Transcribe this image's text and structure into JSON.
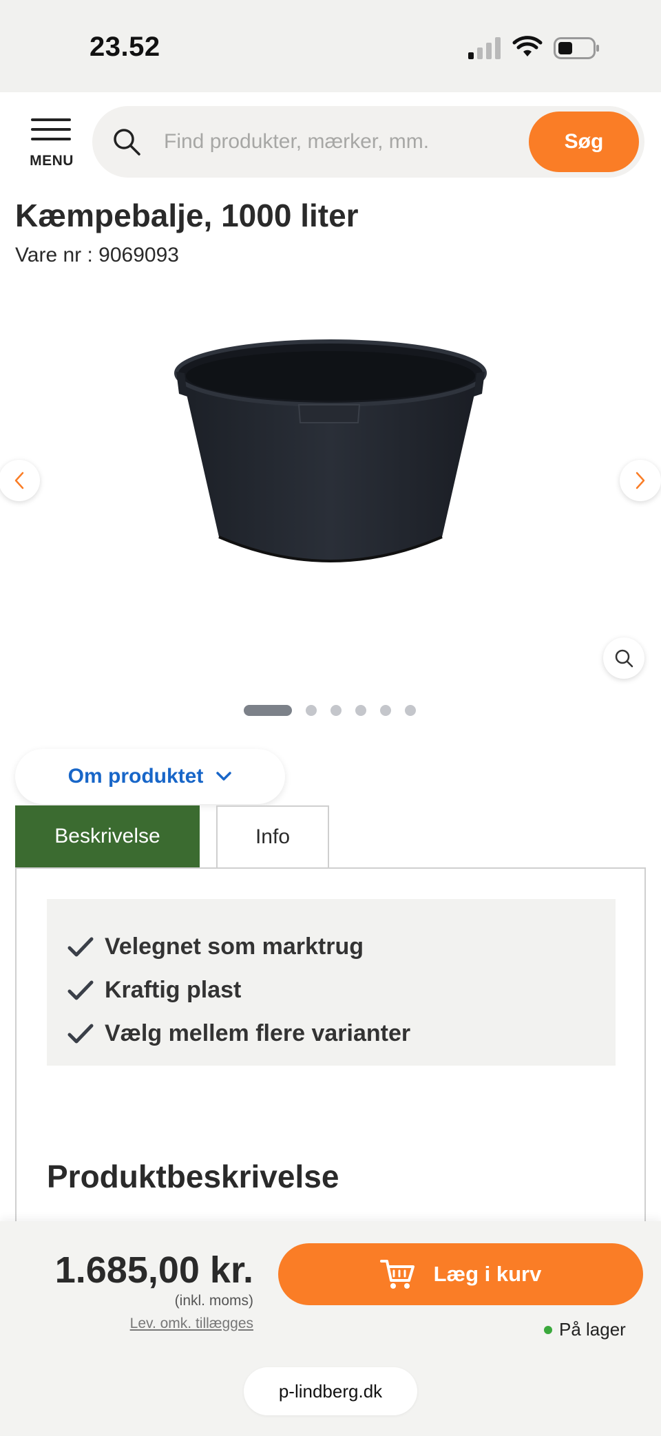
{
  "status_bar": {
    "time": "23.52",
    "signal_icon": "signal-icon",
    "wifi_icon": "wifi-icon",
    "battery_icon": "battery-icon"
  },
  "header": {
    "menu_label": "MENU",
    "search": {
      "placeholder": "Find produkter, mærker, mm.",
      "value": "",
      "button_label": "Søg"
    }
  },
  "product": {
    "title": "Kæmpebalje, 1000 liter",
    "sku": "Vare nr : 9069093"
  },
  "gallery": {
    "image_name": "black-tub-image",
    "total_images": 6,
    "active_index": 0
  },
  "about_button": {
    "label": "Om produktet"
  },
  "tabs": [
    {
      "label": "Beskrivelse",
      "active": true
    },
    {
      "label": "Info",
      "active": false
    }
  ],
  "features": [
    "Velegnet som marktrug",
    "Kraftig plast",
    "Vælg mellem flere varianter"
  ],
  "section_heading": "Produktbeskrivelse",
  "purchase": {
    "price": "1.685,00 kr.",
    "vat_note": "(inkl. moms)",
    "shipping_note": "Lev. omk. tillægges",
    "cart_button": "Læg i kurv",
    "stock_status": "På lager"
  },
  "browser": {
    "url": "p-lindberg.dk"
  },
  "colors": {
    "accent_orange": "#fa7d26",
    "tab_active_green": "#3b6b30",
    "link_blue": "#1866c8",
    "stock_green": "#3aa83c"
  }
}
